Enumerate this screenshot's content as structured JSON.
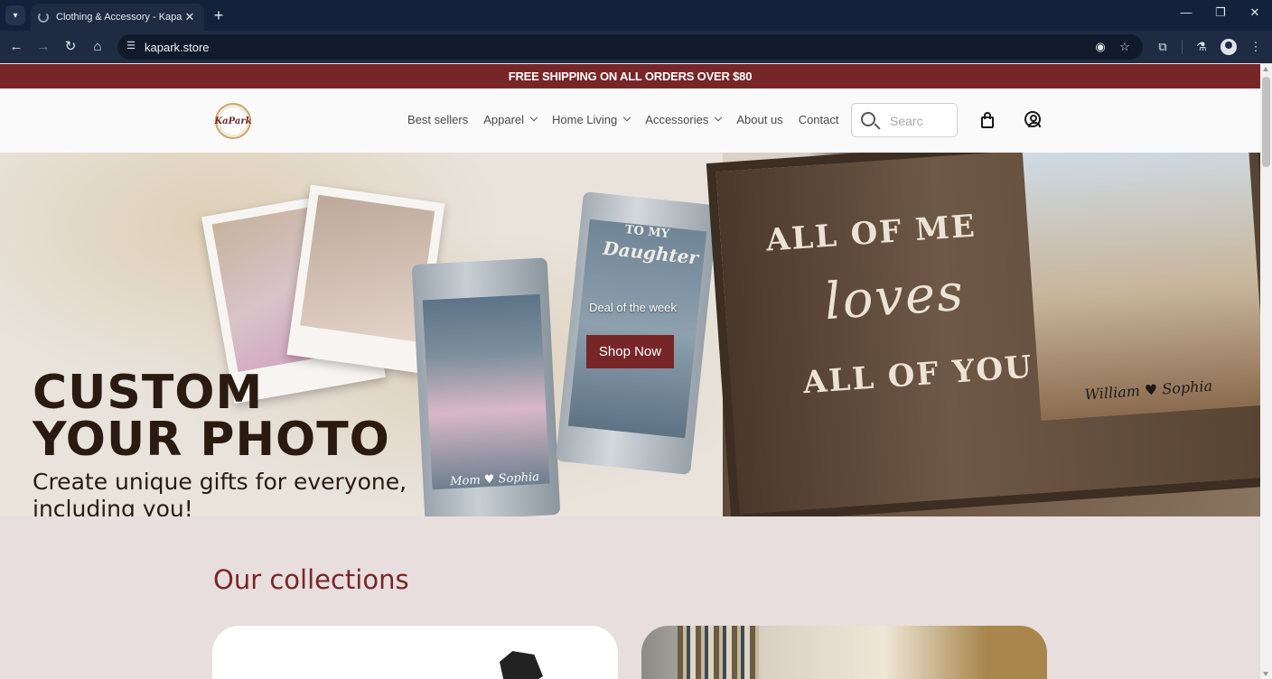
{
  "browser": {
    "tab_title": "Clothing & Accessory - Kapark",
    "url": "kapark.store"
  },
  "announcement": "FREE SHIPPING ON ALL ORDERS OVER $80",
  "header": {
    "logo_text": "KaPark",
    "nav": [
      {
        "label": "Best sellers",
        "dropdown": false
      },
      {
        "label": "Apparel",
        "dropdown": true
      },
      {
        "label": "Home Living",
        "dropdown": true
      },
      {
        "label": "Accessories",
        "dropdown": true
      },
      {
        "label": "About us",
        "dropdown": false
      },
      {
        "label": "Contact",
        "dropdown": false
      }
    ],
    "search_placeholder": "Searc"
  },
  "hero": {
    "title_line1": "CUSTOM",
    "title_line2": "YOUR PHOTO",
    "subtitle": "Create unique gifts for everyone, including you!",
    "deal_label": "Deal of the week",
    "cta_label": "Shop Now",
    "tumbler_text": [
      "TO MY",
      "Daughter",
      "Mom",
      "Sophia"
    ],
    "frame_text": [
      "ALL OF ME",
      "loves",
      "ALL OF YOU",
      "William",
      "Sophia"
    ]
  },
  "collections": {
    "title": "Our collections"
  },
  "colors": {
    "brand": "#772628",
    "chrome": "#13213a"
  }
}
